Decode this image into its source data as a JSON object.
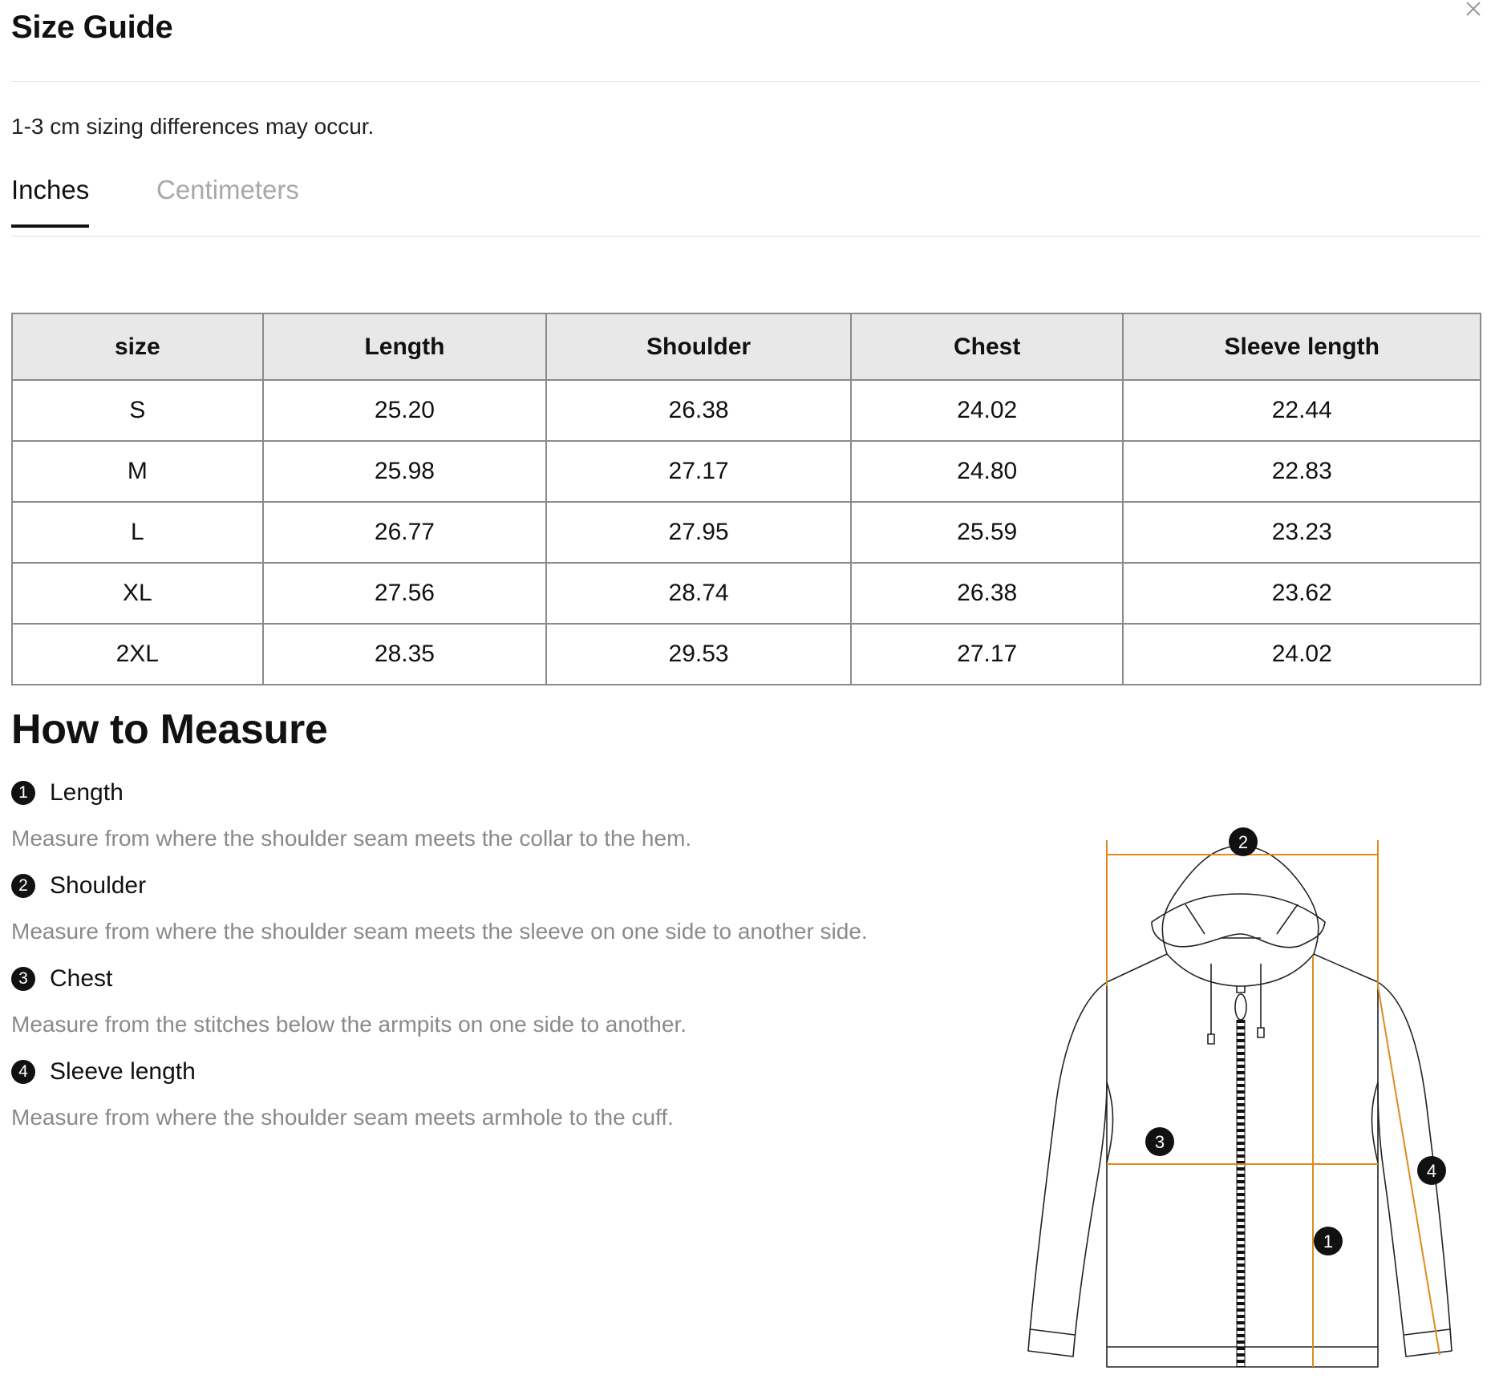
{
  "header": {
    "title": "Size Guide",
    "close_icon": "close-icon"
  },
  "note": "1-3 cm sizing differences may occur.",
  "tabs": [
    {
      "label": "Inches",
      "active": true
    },
    {
      "label": "Centimeters",
      "active": false
    }
  ],
  "table": {
    "columns": [
      "size",
      "Length",
      "Shoulder",
      "Chest",
      "Sleeve length"
    ],
    "rows": [
      [
        "S",
        "25.20",
        "26.38",
        "24.02",
        "22.44"
      ],
      [
        "M",
        "25.98",
        "27.17",
        "24.80",
        "22.83"
      ],
      [
        "L",
        "26.77",
        "27.95",
        "25.59",
        "23.23"
      ],
      [
        "XL",
        "27.56",
        "28.74",
        "26.38",
        "23.62"
      ],
      [
        "2XL",
        "28.35",
        "29.53",
        "27.17",
        "24.02"
      ]
    ]
  },
  "measure": {
    "title": "How to Measure",
    "items": [
      {
        "num": "1",
        "label": "Length",
        "desc": "Measure from where the shoulder seam meets the collar to the hem."
      },
      {
        "num": "2",
        "label": "Shoulder",
        "desc": "Measure from where the shoulder seam meets the sleeve on one side to another side."
      },
      {
        "num": "3",
        "label": "Chest",
        "desc": "Measure from the stitches below the armpits on one side to another."
      },
      {
        "num": "4",
        "label": "Sleeve length",
        "desc": "Measure from where the shoulder seam meets armhole to the cuff."
      }
    ],
    "diagram_markers": [
      "1",
      "2",
      "3",
      "4"
    ],
    "accent_color": "#e08a1e"
  }
}
